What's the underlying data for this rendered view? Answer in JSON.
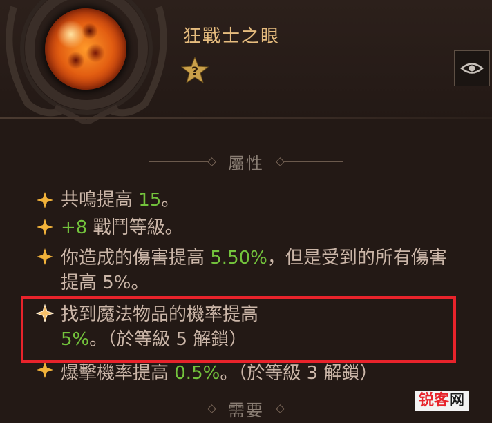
{
  "item": {
    "name": "狂戰士之眼",
    "gem_colors": {
      "core": "#ff9a2a",
      "mid": "#e35f12",
      "edge": "#5a1206"
    },
    "badge_glyph": "?",
    "badge_icon": "star-question-icon",
    "eye_icon": "eye-icon"
  },
  "sections": {
    "attributes_label": "屬性",
    "requirements_label": "需要"
  },
  "affixes": [
    {
      "pre": "共鳴提高 ",
      "num": "15",
      "post": "。"
    },
    {
      "pre": "",
      "num": "+8",
      "post": " 戰鬥等級。"
    },
    {
      "pre": "你造成的傷害提高 ",
      "num": "5.50%",
      "post": "，但是受到的所有傷害提高 5%。"
    },
    {
      "pre": "找到魔法物品的機率提高 ",
      "num": "5%",
      "post": "。（於等級 5 解鎖）"
    },
    {
      "pre": "爆擊機率提高 ",
      "num": "0.5%",
      "post": "。（於等級 3 解鎖）"
    }
  ],
  "colors": {
    "title": "#e6bc7e",
    "affix_text": "#cbb6a8",
    "affix_number": "#73c33c",
    "heading": "#8a7e74",
    "highlight": "#e8232b"
  },
  "watermark": {
    "part_a": "锐客",
    "part_b": "网"
  }
}
